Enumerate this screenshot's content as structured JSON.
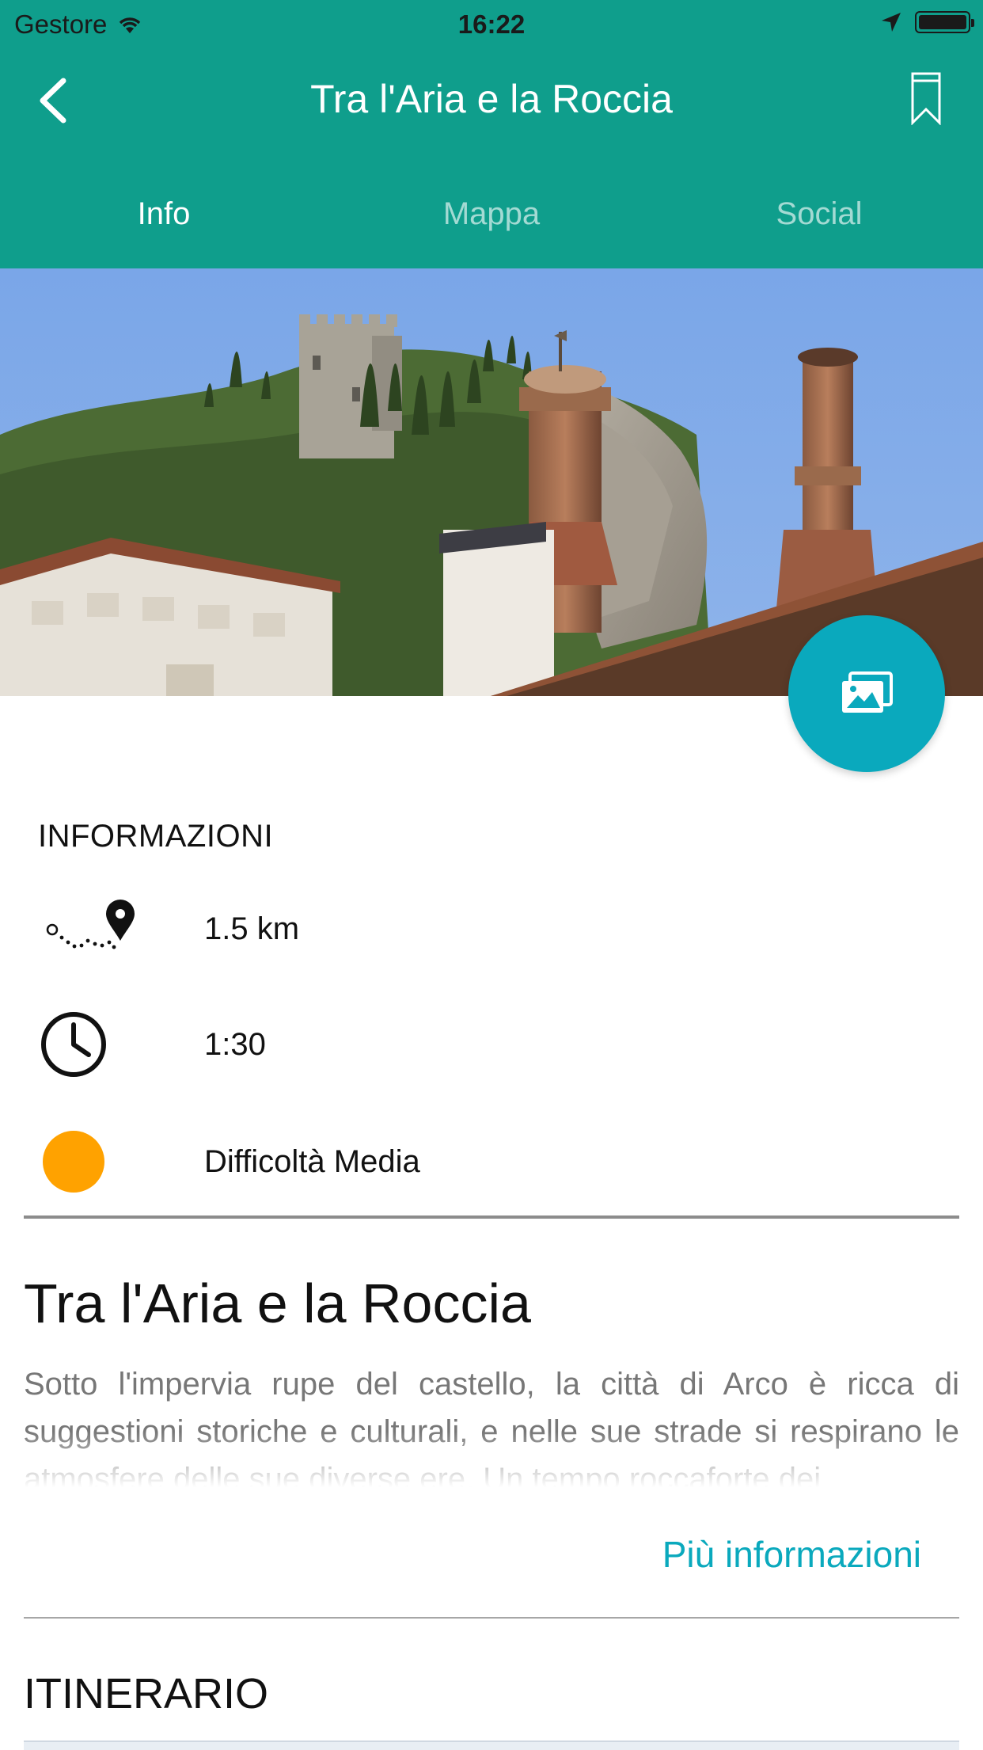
{
  "status_bar": {
    "carrier": "Gestore",
    "time": "16:22"
  },
  "nav": {
    "title": "Tra l'Aria e la Roccia"
  },
  "tabs": [
    {
      "label": "Info",
      "active": true
    },
    {
      "label": "Mappa",
      "active": false
    },
    {
      "label": "Social",
      "active": false
    }
  ],
  "info": {
    "section_title": "INFORMAZIONI",
    "distance": "1.5 km",
    "duration": "1:30",
    "difficulty": "Difficoltà Media",
    "difficulty_color": "#ffa200"
  },
  "content": {
    "title": "Tra l'Aria e la Roccia",
    "description": "Sotto l'impervia rupe del castello, la città di Arco è ricca di suggestioni storiche e culturali, e nelle sue strade si respirano le atmosfere delle sue diverse ere. Un tempo roccaforte dei",
    "more_link": "Più informazioni"
  },
  "itinerary": {
    "title": "ITINERARIO"
  },
  "colors": {
    "header": "#0f9e8c",
    "accent": "#0aa9bd"
  }
}
